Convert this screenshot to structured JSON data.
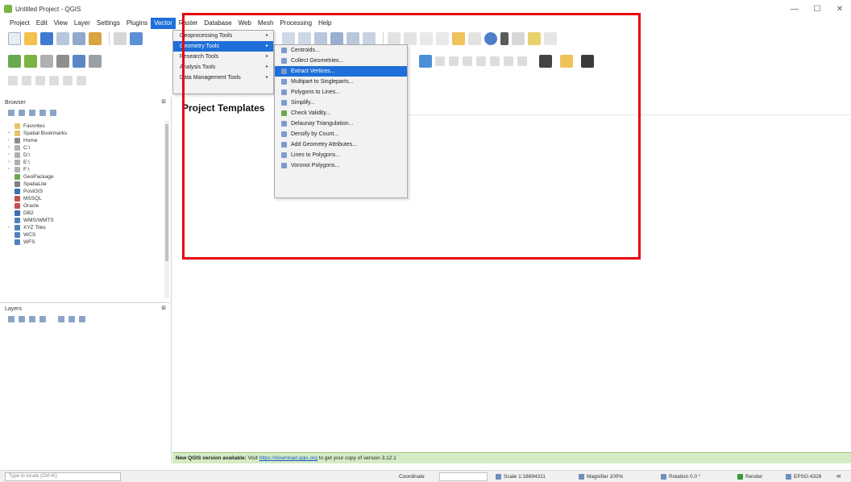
{
  "window": {
    "title": "Untitled Project - QGIS",
    "minimize": "—",
    "restore": "☐"
  },
  "menubar": [
    "Project",
    "Edit",
    "View",
    "Layer",
    "Settings",
    "Plugins",
    "Vector",
    "Raster",
    "Database",
    "Web",
    "Mesh",
    "Processing",
    "Help"
  ],
  "menubar_active_index": 6,
  "toolbar_icons": {
    "row1": [
      "new-project-icon",
      "open-project-icon",
      "save-project-icon",
      "print-layout-icon",
      "layout-manager-icon",
      "style-manager-icon",
      "pan-icon",
      "identify-icon",
      "zoom-in-icon",
      "zoom-out-icon",
      "zoom-full-icon",
      "refresh-icon",
      "select-icon",
      "attribute-table-icon",
      "statistics-icon",
      "measure-icon",
      "annotation-icon",
      "label-icon"
    ],
    "row2": [
      "add-vector-icon",
      "add-raster-icon",
      "digitize-icon",
      "edit-icon",
      "save-edits-icon",
      "add-feature-icon",
      "node-tool-icon",
      "capture-icon",
      "layer-props-icon",
      "gps-icon"
    ]
  },
  "browser_panel": {
    "title": "Browser",
    "close": "⊠",
    "items": [
      {
        "label": "Favorites",
        "color": "#e6c36a",
        "arrow": ""
      },
      {
        "label": "Spatial Bookmarks",
        "color": "#e6c36a",
        "arrow": "›"
      },
      {
        "label": "Home",
        "color": "#8b8b8b",
        "arrow": "›"
      },
      {
        "label": "C:\\",
        "color": "#b0b0b0",
        "arrow": "›"
      },
      {
        "label": "D:\\",
        "color": "#b0b0b0",
        "arrow": "›"
      },
      {
        "label": "E:\\",
        "color": "#b0b0b0",
        "arrow": "›"
      },
      {
        "label": "F:\\",
        "color": "#b0b0b0",
        "arrow": "›"
      },
      {
        "label": "GeoPackage",
        "color": "#6aa84f",
        "arrow": ""
      },
      {
        "label": "SpatiaLite",
        "color": "#7f7f7f",
        "arrow": ""
      },
      {
        "label": "PostGIS",
        "color": "#3d6fb5",
        "arrow": ""
      },
      {
        "label": "MSSQL",
        "color": "#c0504d",
        "arrow": ""
      },
      {
        "label": "Oracle",
        "color": "#c0504d",
        "arrow": ""
      },
      {
        "label": "DB2",
        "color": "#3d6fb5",
        "arrow": ""
      },
      {
        "label": "WMS/WMTS",
        "color": "#4f81bd",
        "arrow": ""
      },
      {
        "label": "XYZ Tiles",
        "color": "#4f81bd",
        "arrow": "›"
      },
      {
        "label": "WCS",
        "color": "#4f81bd",
        "arrow": ""
      },
      {
        "label": "WFS",
        "color": "#4f81bd",
        "arrow": ""
      }
    ]
  },
  "layers_panel": {
    "title": "Layers",
    "close": "⊠"
  },
  "main": {
    "templates_title": "Project Templates"
  },
  "vector_menu": [
    {
      "label": "Geoprocessing Tools",
      "has_submenu": true
    },
    {
      "label": "Geometry Tools",
      "has_submenu": true,
      "selected": true
    },
    {
      "label": "Research Tools",
      "has_submenu": true
    },
    {
      "label": "Analysis Tools",
      "has_submenu": true
    },
    {
      "label": "Data Management Tools",
      "has_submenu": true
    }
  ],
  "geometry_menu": [
    {
      "label": "Centroids...",
      "color": "#7a9ccf"
    },
    {
      "label": "Collect Geometries...",
      "color": "#7a9ccf"
    },
    {
      "label": "Extract Vertices...",
      "color": "#7a9ccf",
      "selected": true
    },
    {
      "label": "Multipart to Singleparts...",
      "color": "#7a9ccf"
    },
    {
      "label": "Polygons to Lines...",
      "color": "#7a9ccf"
    },
    {
      "label": "Simplify...",
      "color": "#7a9ccf"
    },
    {
      "label": "Check Validity...",
      "color": "#6aa84f"
    },
    {
      "label": "Delaunay Triangulation...",
      "color": "#7a9ccf"
    },
    {
      "label": "Densify by Count...",
      "color": "#7a9ccf"
    },
    {
      "label": "Add Geometry Attributes...",
      "color": "#7a9ccf"
    },
    {
      "label": "Lines to Polygons...",
      "color": "#7a9ccf"
    },
    {
      "label": "Voronoi Polygons...",
      "color": "#7a9ccf"
    }
  ],
  "message_bar": {
    "bold": "New QGIS version available:",
    "text1": " Visit ",
    "link": "https://download.qgis.org",
    "text2": " to get your copy of version 3.12.1"
  },
  "statusbar": {
    "locator_placeholder": "Type to locate (Ctrl+K)",
    "coordinate_label": "Coordinate",
    "scale": "Scale 1:18894311",
    "magnifier": "Magnifier 100%",
    "rotation": "Rotation 0.0 °",
    "render": "Render",
    "crs": "EPSG:4326"
  },
  "colors": {
    "accent": "#1e6fd9",
    "highlight_box": "#e8000d",
    "message_bar": "#d4ecc4"
  }
}
